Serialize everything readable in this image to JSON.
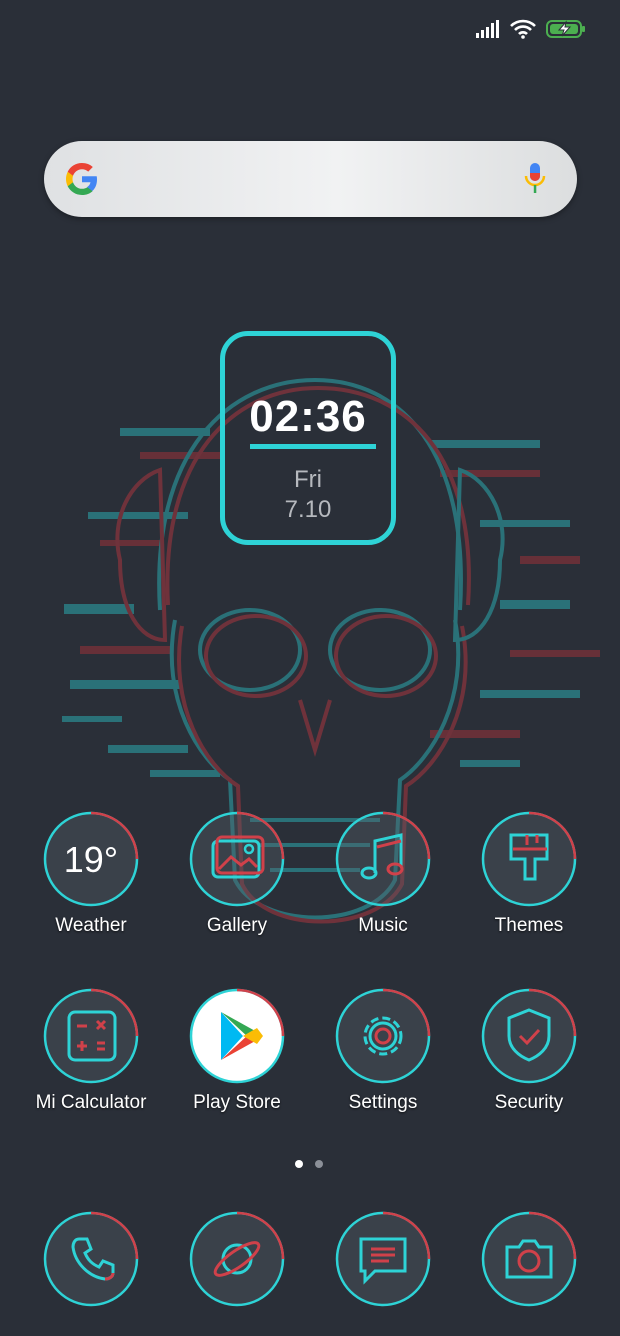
{
  "status_bar": {
    "signal_icon": "signal-icon",
    "wifi_icon": "wifi-icon",
    "battery_icon": "battery-charging-icon"
  },
  "search_bar": {
    "logo": "google-logo",
    "mic_icon": "mic-icon"
  },
  "clock_widget": {
    "time": "02:36",
    "day": "Fri",
    "date": "7.10"
  },
  "apps_row1": [
    {
      "label": "Weather",
      "icon": "weather-icon",
      "temperature": "19°"
    },
    {
      "label": "Gallery",
      "icon": "gallery-icon"
    },
    {
      "label": "Music",
      "icon": "music-icon"
    },
    {
      "label": "Themes",
      "icon": "themes-icon"
    }
  ],
  "apps_row2": [
    {
      "label": "Mi Calculator",
      "icon": "calculator-icon"
    },
    {
      "label": "Play Store",
      "icon": "play-store-icon"
    },
    {
      "label": "Settings",
      "icon": "settings-icon"
    },
    {
      "label": "Security",
      "icon": "security-icon"
    }
  ],
  "page_indicator": {
    "pages": 2,
    "current": 1
  },
  "dock": [
    {
      "icon": "phone-icon"
    },
    {
      "icon": "browser-icon"
    },
    {
      "icon": "messages-icon"
    },
    {
      "icon": "camera-icon"
    }
  ],
  "colors": {
    "background": "#2a2f38",
    "cyan": "#2ed3d6",
    "red": "#d0414a"
  }
}
